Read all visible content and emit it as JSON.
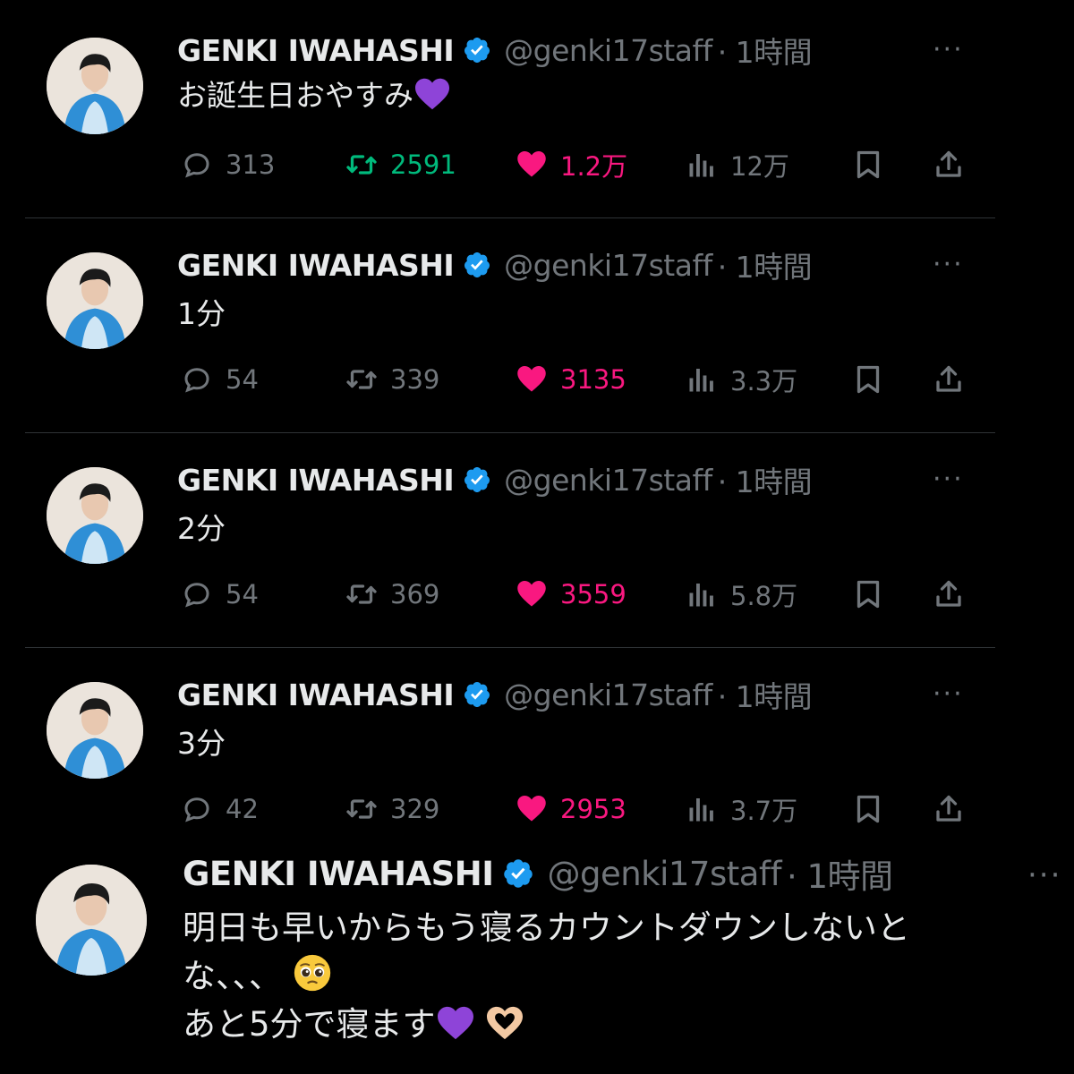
{
  "tweets": [
    {
      "name": "GENKI IWAHASHI",
      "handle": "@genki17staff",
      "time": "· 1時間",
      "text": "お誕生日おやすみ",
      "emoji": "purple-heart",
      "stats": {
        "replies": "313",
        "retweets": "2591",
        "likes": "1.2万",
        "views": "12万"
      },
      "retweeted": true
    },
    {
      "name": "GENKI IWAHASHI",
      "handle": "@genki17staff",
      "time": "· 1時間",
      "text": "1分",
      "stats": {
        "replies": "54",
        "retweets": "339",
        "likes": "3135",
        "views": "3.3万"
      },
      "retweeted": false
    },
    {
      "name": "GENKI IWAHASHI",
      "handle": "@genki17staff",
      "time": "· 1時間",
      "text": "2分",
      "stats": {
        "replies": "54",
        "retweets": "369",
        "likes": "3559",
        "views": "5.8万"
      },
      "retweeted": false
    },
    {
      "name": "GENKI IWAHASHI",
      "handle": "@genki17staff",
      "time": "· 1時間",
      "text": "3分",
      "stats": {
        "replies": "42",
        "retweets": "329",
        "likes": "2953",
        "views": "3.7万"
      },
      "retweeted": false
    },
    {
      "name": "GENKI IWAHASHI",
      "handle": "@genki17staff",
      "time": "· 1時間",
      "line1": "明日も早いからもう寝るカウントダウンしないと",
      "line2": "な、、、",
      "line3": "あと5分で寝ます",
      "emojis": [
        "pleading-face",
        "purple-heart",
        "heart-hands"
      ]
    }
  ],
  "more_label": "···",
  "colors": {
    "background": "#000000",
    "text": "#e7e9ea",
    "muted": "#71767b",
    "verified": "#1d9bf0",
    "retweet": "#00ba7c",
    "like": "#f91880",
    "divider": "#2f3336"
  }
}
